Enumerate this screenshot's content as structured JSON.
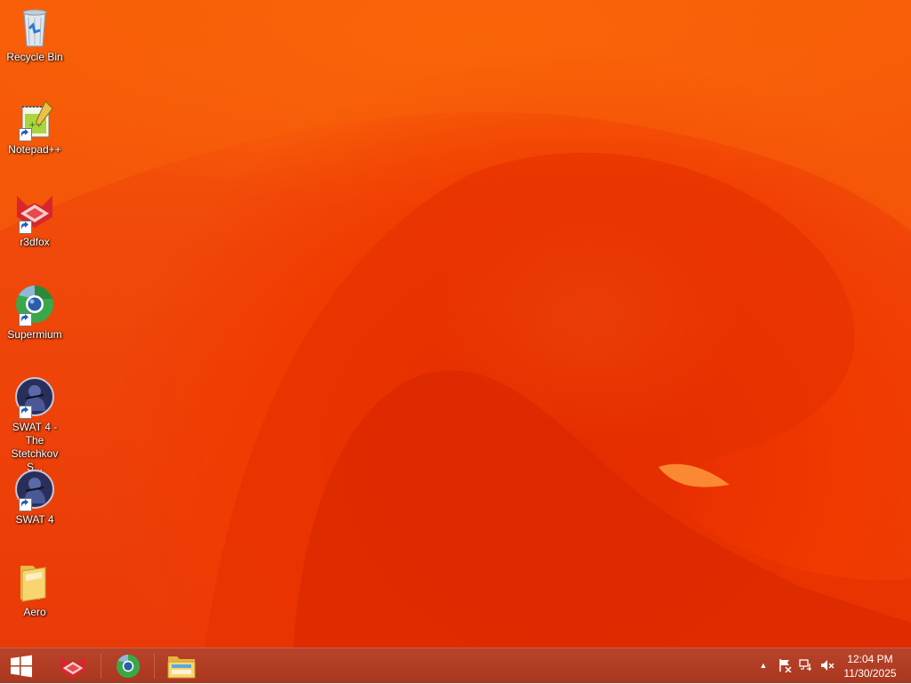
{
  "desktop": {
    "icons": [
      {
        "label": "Recycle Bin",
        "icon": "recycle-bin-icon"
      },
      {
        "label": "Notepad++",
        "icon": "notepad-plus-plus-icon"
      },
      {
        "label": "r3dfox",
        "icon": "r3dfox-icon"
      },
      {
        "label": "Supermium",
        "icon": "supermium-icon"
      },
      {
        "label": "SWAT 4 - The Stetchkov S...",
        "icon": "swat4-expansion-icon"
      },
      {
        "label": "SWAT 4",
        "icon": "swat4-icon"
      },
      {
        "label": "Aero",
        "icon": "folder-icon"
      }
    ]
  },
  "taskbar": {
    "start": {
      "icon": "windows-start-icon"
    },
    "pinned": [
      {
        "icon": "r3dfox-icon"
      },
      {
        "icon": "supermium-icon"
      },
      {
        "icon": "file-explorer-icon"
      }
    ],
    "tray": {
      "show_hidden": "▲",
      "icons": [
        "action-center-flag-icon",
        "network-icon",
        "volume-muted-icon"
      ]
    },
    "clock": {
      "time": "12:04 PM",
      "date": "11/30/2025"
    }
  },
  "colors": {
    "wallpaper": "#f04a08",
    "taskbar": "#ad3c23"
  }
}
